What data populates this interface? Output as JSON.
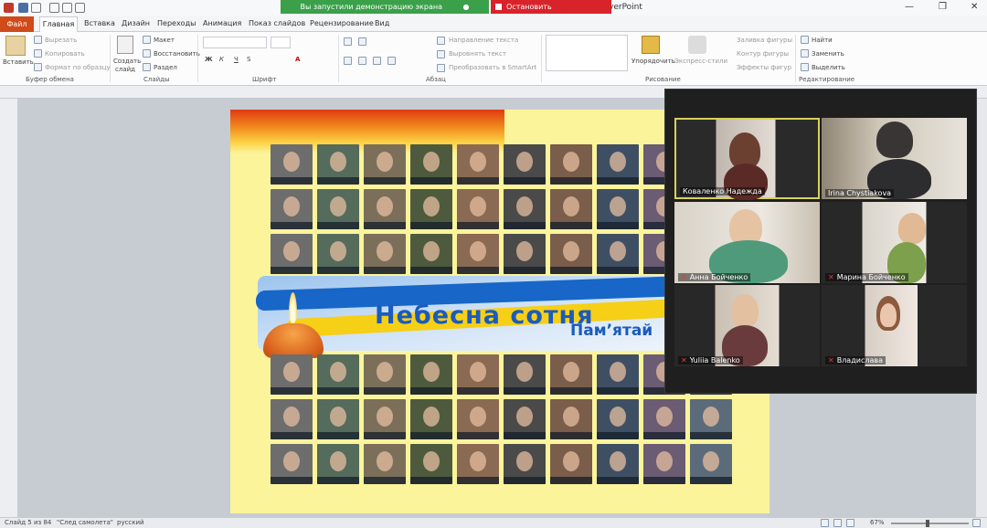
{
  "app": {
    "title": "verPoint"
  },
  "share": {
    "banner_text": "Вы запустили демонстрацию экрана",
    "stop_text": "Остановить демонстрацию"
  },
  "tabs": [
    "Главная",
    "Вставка",
    "Дизайн",
    "Переходы",
    "Анимация",
    "Показ слайдов",
    "Рецензирование",
    "Вид"
  ],
  "file_tab": "Файл",
  "ribbon": {
    "paste": "Вставить",
    "cut": "Вырезать",
    "copy": "Копировать",
    "format_painter": "Формат по образцу",
    "new_slide": "Создать",
    "new_slide2": "слайд",
    "layout": "Макет",
    "reset": "Восстановить",
    "section": "Раздел",
    "text_direction": "Направление текста",
    "align_text": "Выровнять текст",
    "smartart": "Преобразовать в SmartArt",
    "arrange": "Упорядочить",
    "quick_styles": "Экспресс-стили",
    "shape_fill": "Заливка фигуры",
    "shape_outline": "Контур фигуры",
    "shape_effects": "Эффекты фигур",
    "find": "Найти",
    "replace": "Заменить",
    "select": "Выделить",
    "groups": {
      "clipboard": "Буфер обмена",
      "slides": "Слайды",
      "font": "Шрифт",
      "paragraph": "Абзац",
      "drawing": "Рисование",
      "editing": "Редактирование"
    }
  },
  "slide": {
    "title": "Небесна сотня",
    "subtitle": "Пам’ятай"
  },
  "participants": [
    {
      "name": "Коваленко Надежда",
      "muted": false
    },
    {
      "name": "Irina Chystiakova",
      "muted": false
    },
    {
      "name": "Анна Бойченко",
      "muted": true
    },
    {
      "name": "Марина Бойченко",
      "muted": true
    },
    {
      "name": "Yuliia Balenko",
      "muted": true
    },
    {
      "name": "Владислава",
      "muted": true
    }
  ],
  "status": {
    "slide": "Слайд 5 из 84",
    "theme": "\"След самолета\"",
    "lang": "русский",
    "zoom": "67%"
  }
}
